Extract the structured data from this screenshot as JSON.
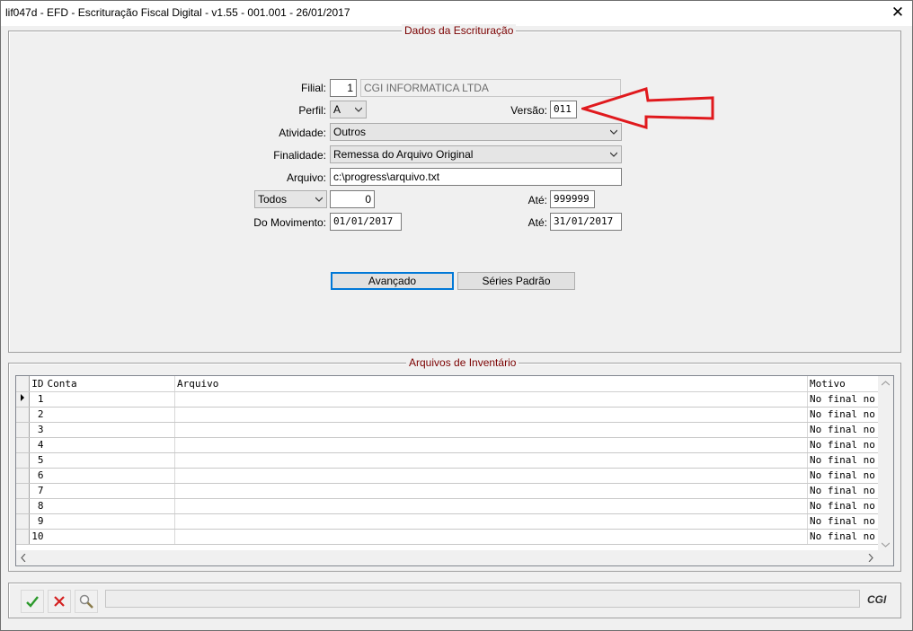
{
  "window": {
    "title": "lif047d - EFD - Escrituração Fiscal Digital - v1.55 - 001.001 - 26/01/2017"
  },
  "dados": {
    "group_title": "Dados da Escrituração",
    "filial": {
      "label": "Filial:",
      "code": "1",
      "name": "CGI INFORMATICA LTDA"
    },
    "perfil": {
      "label": "Perfil:",
      "value": "A"
    },
    "versao": {
      "label": "Versão:",
      "value": "011"
    },
    "atividade": {
      "label": "Atividade:",
      "value": "Outros"
    },
    "finalidade": {
      "label": "Finalidade:",
      "value": "Remessa do Arquivo Original"
    },
    "arquivo": {
      "label": "Arquivo:",
      "value": "c:\\progress\\arquivo.txt"
    },
    "filtro": {
      "value": "Todos",
      "from": "0",
      "ate_label": "Até:",
      "to": "999999"
    },
    "movimento": {
      "label": "Do Movimento:",
      "from": "01/01/2017",
      "ate_label": "Até:",
      "to": "31/01/2017"
    },
    "buttons": {
      "avancado": "Avançado",
      "series": "Séries Padrão"
    }
  },
  "inventario": {
    "group_title": "Arquivos de Inventário",
    "columns": {
      "id": "ID",
      "conta": "Conta",
      "arquivo": "Arquivo",
      "motivo": "Motivo"
    },
    "rows": [
      {
        "id": "1",
        "conta": "",
        "arquivo": "",
        "motivo": "No final no"
      },
      {
        "id": "2",
        "conta": "",
        "arquivo": "",
        "motivo": "No final no"
      },
      {
        "id": "3",
        "conta": "",
        "arquivo": "",
        "motivo": "No final no"
      },
      {
        "id": "4",
        "conta": "",
        "arquivo": "",
        "motivo": "No final no"
      },
      {
        "id": "5",
        "conta": "",
        "arquivo": "",
        "motivo": "No final no"
      },
      {
        "id": "6",
        "conta": "",
        "arquivo": "",
        "motivo": "No final no"
      },
      {
        "id": "7",
        "conta": "",
        "arquivo": "",
        "motivo": "No final no"
      },
      {
        "id": "8",
        "conta": "",
        "arquivo": "",
        "motivo": "No final no"
      },
      {
        "id": "9",
        "conta": "",
        "arquivo": "",
        "motivo": "No final no"
      },
      {
        "id": "10",
        "conta": "",
        "arquivo": "",
        "motivo": "No final no"
      }
    ]
  },
  "footer": {
    "logo_text": "CGI"
  },
  "colors": {
    "group_title": "#7b0000",
    "annotation_arrow": "#e0191d",
    "ok_icon": "#2c9a2c",
    "cancel_icon": "#d42020"
  },
  "icons": [
    "close-icon",
    "chevron-down-icon",
    "row-pointer-icon",
    "checkmark-icon",
    "cancel-x-icon",
    "search-magnifier-icon"
  ]
}
